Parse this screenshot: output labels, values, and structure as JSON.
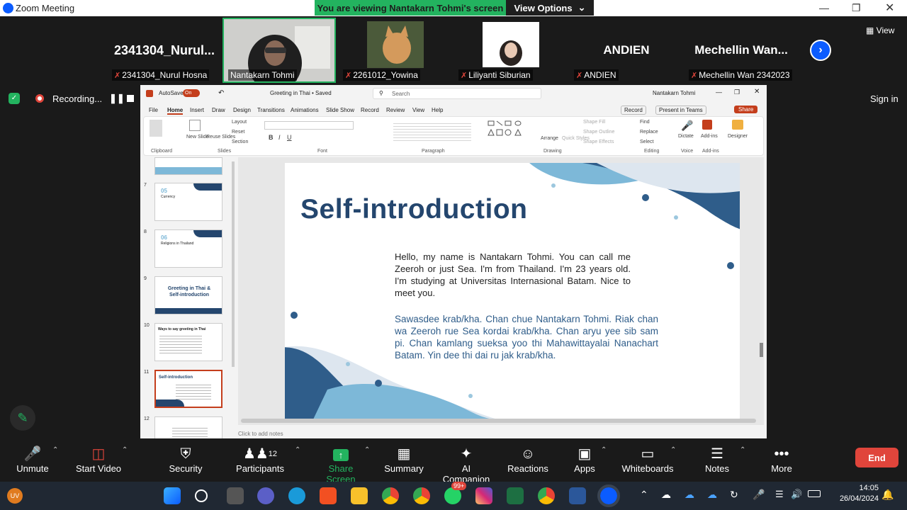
{
  "window": {
    "title": "Zoom Meeting"
  },
  "banner": {
    "viewing": "You are viewing Nantakarn Tohmi's screen",
    "view_options": "View Options"
  },
  "participants": [
    {
      "tile_text": "2341304_Nurul...",
      "label": "2341304_Nurul Hosna",
      "muted": true
    },
    {
      "tile_text": "",
      "label": "Nantakarn Tohmi",
      "muted": false
    },
    {
      "tile_text": "",
      "label": "2261012_Yowina",
      "muted": true
    },
    {
      "tile_text": "",
      "label": "Liliyanti Siburian",
      "muted": true
    },
    {
      "tile_text": "ANDIEN",
      "label": "ANDIEN",
      "muted": true
    },
    {
      "tile_text": "Mechellin  Wan...",
      "label": "Mechellin Wan 2342023",
      "muted": true
    }
  ],
  "gallery": {
    "view_label": "View"
  },
  "recording": {
    "label": "Recording..."
  },
  "signin": "Sign in",
  "ppt": {
    "autosave": "AutoSave",
    "autosave_state": "On",
    "doc": "Greeting in Thai • Saved",
    "search": "Search",
    "user": "Nantakarn Tohmi",
    "record_btn": "Record",
    "present_btn": "Present in Teams",
    "share_btn": "Share",
    "menu": [
      "File",
      "Home",
      "Insert",
      "Draw",
      "Design",
      "Transitions",
      "Animations",
      "Slide Show",
      "Record",
      "Review",
      "View",
      "Help"
    ],
    "groups": [
      "Clipboard",
      "Slides",
      "Font",
      "Paragraph",
      "Drawing",
      "Editing",
      "Voice",
      "Add-ins"
    ],
    "ribbon_buttons": {
      "paste": "Paste",
      "new_slide": "New Slide",
      "reuse": "Reuse Slides",
      "layout": "Layout",
      "reset": "Reset",
      "section": "Section",
      "arrange": "Arrange",
      "quick_styles": "Quick Styles",
      "shape_fill": "Shape Fill",
      "shape_outline": "Shape Outline",
      "shape_effects": "Shape Effects",
      "find": "Find",
      "replace": "Replace",
      "select": "Select",
      "dictate": "Dictate",
      "addins": "Add-ins",
      "designer": "Designer"
    },
    "thumbnails": [
      {
        "num": "7",
        "title": "05",
        "sub": "Currency"
      },
      {
        "num": "8",
        "title": "06",
        "sub": "Religions in Thailand"
      },
      {
        "num": "9",
        "title": "Greeting in Thai & Self-introduction",
        "sub": ""
      },
      {
        "num": "10",
        "title": "Ways to say greeting in Thai",
        "sub": ""
      },
      {
        "num": "11",
        "title": "Self-introduction",
        "sub": ""
      },
      {
        "num": "12",
        "title": "",
        "sub": ""
      }
    ],
    "slide": {
      "title": "Self-introduction",
      "para1": "Hello, my name is Nantakarn Tohmi. You can call me Zeeroh or just Sea. I'm from Thailand. I'm 23 years old. I'm studying at Universitas Internasional Batam. Nice to meet you.",
      "para2": "Sawasdee krab/kha. Chan chue Nantakarn Tohmi. Riak chan wa Zeeroh rue Sea kordai krab/kha. Chan aryu yee sib sam pi. Chan kamlang sueksa yoo thi Mahawittayalai Nanachart Batam. Yin dee thi dai ru jak krab/kha."
    },
    "notes": "Click to add notes"
  },
  "toolbar": [
    {
      "label": "Unmute",
      "icon": "mic-off-icon"
    },
    {
      "label": "Start Video",
      "icon": "video-off-icon"
    },
    {
      "label": "Security",
      "icon": "shield-icon"
    },
    {
      "label": "Participants",
      "icon": "participants-icon",
      "count": "12"
    },
    {
      "label": "Share Screen",
      "icon": "share-screen-icon"
    },
    {
      "label": "Summary",
      "icon": "summary-icon"
    },
    {
      "label": "AI Companion",
      "icon": "ai-companion-icon"
    },
    {
      "label": "Reactions",
      "icon": "reactions-icon"
    },
    {
      "label": "Apps",
      "icon": "apps-icon"
    },
    {
      "label": "Whiteboards",
      "icon": "whiteboard-icon"
    },
    {
      "label": "Notes",
      "icon": "notes-icon"
    },
    {
      "label": "More",
      "icon": "more-icon"
    }
  ],
  "end_label": "End",
  "taskbar": {
    "time": "14:05",
    "date": "26/04/2024",
    "badge": "99+",
    "avatar": "UV"
  },
  "colors": {
    "zoom_blue": "#0b5cff",
    "green": "#23b35f",
    "red": "#e0453b",
    "slide_blue": "#24466e"
  }
}
